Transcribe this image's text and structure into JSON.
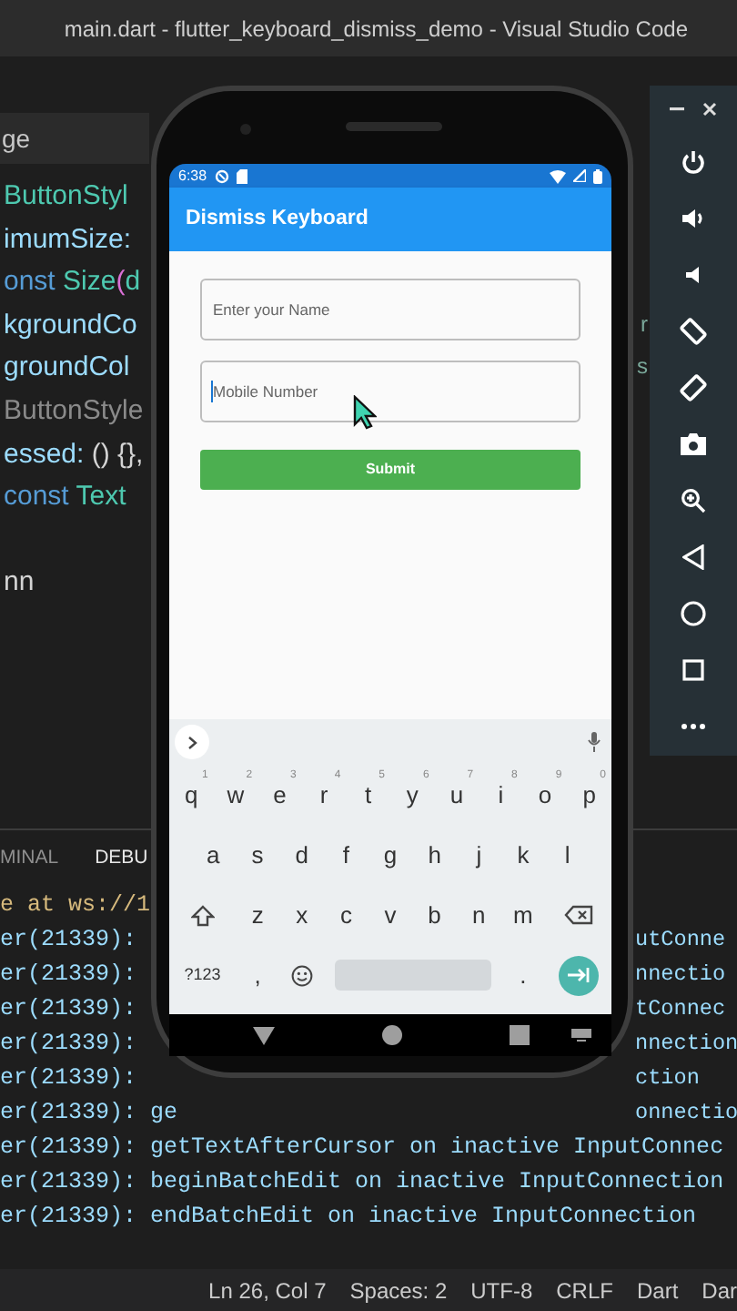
{
  "window": {
    "title": "main.dart - flutter_keyboard_dismiss_demo - Visual Studio Code"
  },
  "editor": {
    "tab": {
      "label": "ge"
    },
    "lines": [
      {
        "tokens": [
          {
            "text": "ButtonStyl",
            "kind": "type"
          }
        ]
      },
      {
        "tokens": [
          {
            "text": "imumSize:",
            "kind": "property"
          }
        ]
      },
      {
        "tokens": [
          {
            "text": "onst",
            "kind": "keyword"
          },
          {
            "text": " Size",
            "kind": "type"
          },
          {
            "text": "(",
            "kind": "bracket"
          },
          {
            "text": "d",
            "kind": "type"
          }
        ]
      },
      {
        "tokens": [
          {
            "text": "kgroundCo",
            "kind": "property"
          }
        ],
        "tail": "r"
      },
      {
        "tokens": [
          {
            "text": "groundCol",
            "kind": "property"
          }
        ],
        "tail": "s"
      },
      {
        "tokens": [
          {
            "text": "ButtonStyle",
            "kind": "dim"
          }
        ]
      },
      {
        "tokens": [
          {
            "text": "essed:",
            "kind": "property"
          },
          {
            "text": " () {},",
            "kind": "plain"
          }
        ]
      },
      {
        "tokens": [
          {
            "text": " const",
            "kind": "keyword"
          },
          {
            "text": " Text",
            "kind": "type"
          }
        ]
      },
      {
        "tokens": [
          {
            "text": "nn",
            "kind": "plain"
          }
        ],
        "gap_before": true
      }
    ]
  },
  "panel": {
    "tabs": [
      {
        "label": "MINAL",
        "selected": false
      },
      {
        "label": "DEBU",
        "selected": true
      }
    ],
    "lines": [
      {
        "text": "e at ws://1",
        "kind": "notice"
      },
      {
        "text": "er(21339):",
        "kind": "log",
        "tail": "utConne"
      },
      {
        "text": "er(21339):",
        "kind": "log",
        "tail": "nnectio"
      },
      {
        "text": "er(21339):",
        "kind": "log",
        "tail": "tConnec"
      },
      {
        "text": "er(21339):",
        "kind": "log",
        "tail": "nnection"
      },
      {
        "text": "er(21339):",
        "kind": "log",
        "tail": "ction"
      },
      {
        "text": "er(21339): ge",
        "kind": "log",
        "tail": "onnectio"
      },
      {
        "text": "er(21339): getTextAfterCursor on inactive InputConnec",
        "kind": "log"
      },
      {
        "text": "er(21339): beginBatchEdit on inactive InputConnection",
        "kind": "log"
      },
      {
        "text": "er(21339): endBatchEdit on inactive InputConnection",
        "kind": "log"
      }
    ]
  },
  "status_bar": {
    "items": [
      "Ln 26, Col 7",
      "Spaces: 2",
      "UTF-8",
      "CRLF",
      "Dart",
      "Dar"
    ]
  },
  "phone": {
    "status_bar": {
      "time": "6:38"
    },
    "app_bar": {
      "title": "Dismiss Keyboard"
    },
    "form": {
      "fields": [
        {
          "placeholder": "Enter your Name",
          "focused": false
        },
        {
          "placeholder": "Mobile Number",
          "focused": true
        }
      ],
      "submit": {
        "label": "Submit"
      }
    },
    "keyboard": {
      "rows": [
        {
          "keys": [
            {
              "kind": "char",
              "label": "q",
              "hint": "1"
            },
            {
              "kind": "char",
              "label": "w",
              "hint": "2"
            },
            {
              "kind": "char",
              "label": "e",
              "hint": "3"
            },
            {
              "kind": "char",
              "label": "r",
              "hint": "4"
            },
            {
              "kind": "char",
              "label": "t",
              "hint": "5"
            },
            {
              "kind": "char",
              "label": "y",
              "hint": "6"
            },
            {
              "kind": "char",
              "label": "u",
              "hint": "7"
            },
            {
              "kind": "char",
              "label": "i",
              "hint": "8"
            },
            {
              "kind": "char",
              "label": "o",
              "hint": "9"
            },
            {
              "kind": "char",
              "label": "p",
              "hint": "0"
            }
          ]
        },
        {
          "keys": [
            {
              "kind": "char",
              "label": "a"
            },
            {
              "kind": "char",
              "label": "s"
            },
            {
              "kind": "char",
              "label": "d"
            },
            {
              "kind": "char",
              "label": "f"
            },
            {
              "kind": "char",
              "label": "g"
            },
            {
              "kind": "char",
              "label": "h"
            },
            {
              "kind": "char",
              "label": "j"
            },
            {
              "kind": "char",
              "label": "k"
            },
            {
              "kind": "char",
              "label": "l"
            }
          ]
        },
        {
          "keys": [
            {
              "kind": "shift"
            },
            {
              "kind": "char",
              "label": "z"
            },
            {
              "kind": "char",
              "label": "x"
            },
            {
              "kind": "char",
              "label": "c"
            },
            {
              "kind": "char",
              "label": "v"
            },
            {
              "kind": "char",
              "label": "b"
            },
            {
              "kind": "char",
              "label": "n"
            },
            {
              "kind": "char",
              "label": "m"
            },
            {
              "kind": "backspace"
            }
          ]
        },
        {
          "keys": [
            {
              "kind": "text",
              "label": "?123"
            },
            {
              "kind": "char",
              "label": ","
            },
            {
              "kind": "emoji"
            },
            {
              "kind": "space"
            },
            {
              "kind": "char",
              "label": "."
            },
            {
              "kind": "enter"
            }
          ]
        }
      ]
    }
  }
}
